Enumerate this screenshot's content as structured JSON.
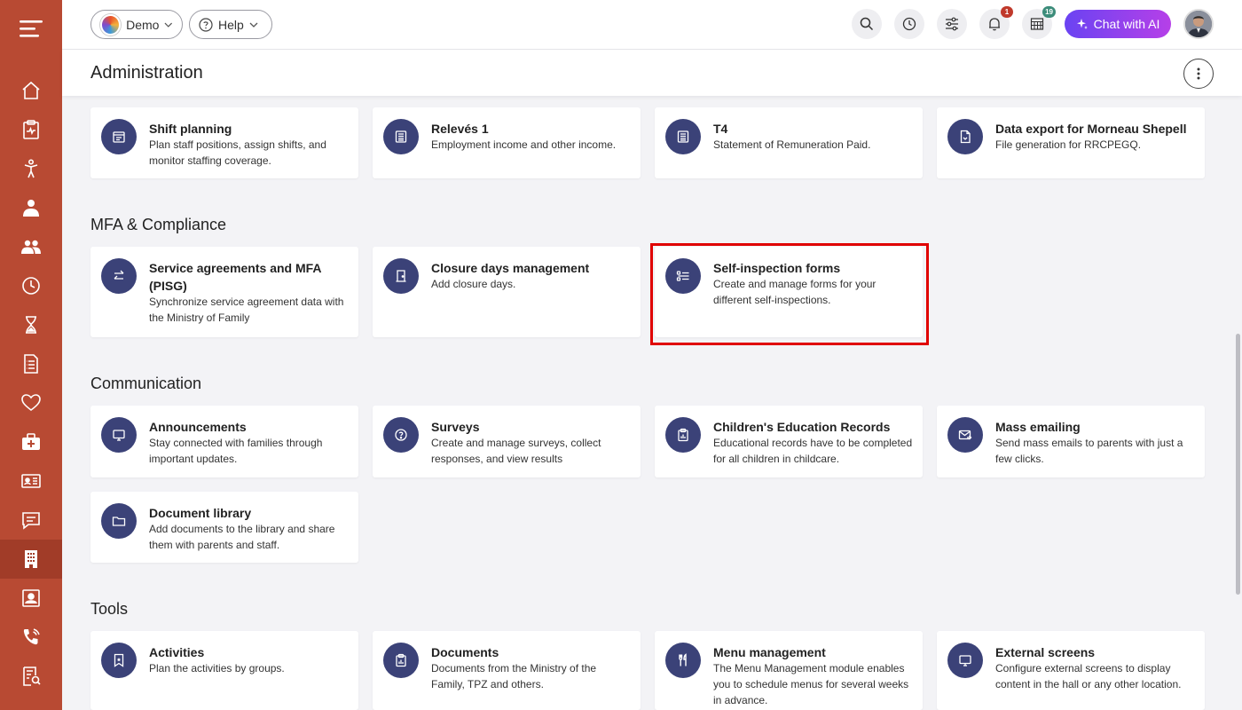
{
  "sidebar": {
    "menu_icon": "menu-icon",
    "items": [
      {
        "name": "home-icon"
      },
      {
        "name": "clipboard-health-icon"
      },
      {
        "name": "child-icon"
      },
      {
        "name": "staff-icon"
      },
      {
        "name": "families-icon"
      },
      {
        "name": "clock-icon"
      },
      {
        "name": "hourglass-icon"
      },
      {
        "name": "billing-list-icon"
      },
      {
        "name": "heart-icon"
      },
      {
        "name": "medical-kit-icon"
      },
      {
        "name": "id-card-icon"
      },
      {
        "name": "messages-icon"
      },
      {
        "name": "building-icon",
        "active": true
      },
      {
        "name": "contact-card-icon"
      },
      {
        "name": "phone-icon"
      },
      {
        "name": "report-search-icon"
      }
    ]
  },
  "topbar": {
    "demo_label": "Demo",
    "help_label": "Help",
    "notifications_badge": "1",
    "calendar_badge": "19",
    "ai_button_label": "Chat with AI"
  },
  "page": {
    "title": "Administration"
  },
  "sections": {
    "mfa_title": "MFA & Compliance",
    "communication_title": "Communication",
    "tools_title": "Tools"
  },
  "cards": {
    "shift_planning": {
      "title": "Shift planning",
      "desc1": "Plan staff positions, assign shifts, and",
      "desc2": "monitor staffing coverage."
    },
    "releves": {
      "title": "Relevés 1",
      "desc1": "Employment income and other income."
    },
    "t4": {
      "title": "T4",
      "desc1": "Statement of Remuneration Paid."
    },
    "data_export": {
      "title": "Data export for Morneau Shepell",
      "desc1": "File generation for RRCPEGQ."
    },
    "service_agreements": {
      "title1": "Service agreements and MFA",
      "title2": "(PISG)",
      "desc1": "Synchronize service agreement data with",
      "desc2": "the Ministry of Family"
    },
    "closure_days": {
      "title": "Closure days management",
      "desc1": "Add closure days."
    },
    "self_inspection": {
      "title": "Self-inspection forms",
      "desc1": "Create and manage forms for your",
      "desc2": "different self-inspections."
    },
    "announcements": {
      "title": "Announcements",
      "desc1": "Stay connected with families through",
      "desc2": "important updates."
    },
    "surveys": {
      "title": "Surveys",
      "desc1": "Create and manage surveys, collect",
      "desc2": "responses, and view results"
    },
    "education_records": {
      "title": "Children's Education Records",
      "desc1": "Educational records have to be completed",
      "desc2": "for all children in childcare."
    },
    "mass_emailing": {
      "title": "Mass emailing",
      "desc1": "Send mass emails to parents with just a",
      "desc2": "few clicks."
    },
    "document_library": {
      "title": "Document library",
      "desc1": "Add documents to the library and share",
      "desc2": "them with parents and staff."
    },
    "activities": {
      "title": "Activities",
      "desc1": "Plan the activities by groups."
    },
    "documents": {
      "title": "Documents",
      "desc1": "Documents from the Ministry of the",
      "desc2": "Family, TPZ and others."
    },
    "menu_management": {
      "title": "Menu management",
      "desc1": "The Menu Management module enables",
      "desc2": "you to schedule menus for several weeks",
      "desc3": "in advance."
    },
    "external_screens": {
      "title": "External screens",
      "desc1": "Configure external screens to display",
      "desc2": "content in the hall or any other location."
    }
  },
  "colors": {
    "sidebar": "#b84a33",
    "icon_circle": "#3b4278",
    "highlight": "#e00000",
    "ai_gradient_start": "#6a43f2",
    "ai_gradient_end": "#b640e8"
  }
}
